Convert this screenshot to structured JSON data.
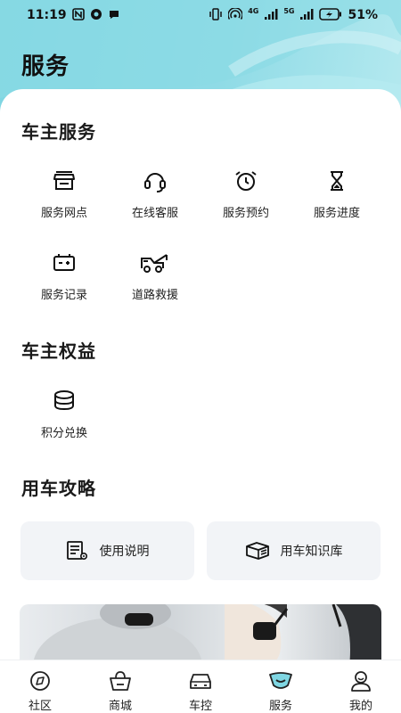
{
  "status_bar": {
    "time": "11:19",
    "network_badge_1": "4G",
    "network_badge_2": "5G",
    "battery": "51%"
  },
  "header": {
    "title": "服务"
  },
  "sections": {
    "owner_services": {
      "title": "车主服务",
      "items": [
        {
          "label": "服务网点",
          "icon": "store-icon"
        },
        {
          "label": "在线客服",
          "icon": "headset-icon"
        },
        {
          "label": "服务预约",
          "icon": "alarm-clock-icon"
        },
        {
          "label": "服务进度",
          "icon": "hourglass-icon"
        },
        {
          "label": "服务记录",
          "icon": "battery-record-icon"
        },
        {
          "label": "道路救援",
          "icon": "tow-truck-icon"
        }
      ]
    },
    "owner_benefits": {
      "title": "车主权益",
      "items": [
        {
          "label": "积分兑换",
          "icon": "coin-stack-icon"
        }
      ]
    },
    "car_guide": {
      "title": "用车攻略",
      "buttons": [
        {
          "label": "使用说明",
          "icon": "manual-icon"
        },
        {
          "label": "用车知识库",
          "icon": "book-stack-icon"
        }
      ]
    }
  },
  "tabbar": {
    "items": [
      {
        "label": "社区",
        "icon": "community-icon",
        "active": false
      },
      {
        "label": "商城",
        "icon": "basket-icon",
        "active": false
      },
      {
        "label": "车控",
        "icon": "car-icon",
        "active": false
      },
      {
        "label": "服务",
        "icon": "service-icon",
        "active": true
      },
      {
        "label": "我的",
        "icon": "profile-icon",
        "active": false
      }
    ]
  },
  "colors": {
    "header_bg": "#7fd6e2",
    "active_tab_accent": "#7fd6e2",
    "card_bg": "#ffffff",
    "button_bg": "#f2f4f7"
  }
}
